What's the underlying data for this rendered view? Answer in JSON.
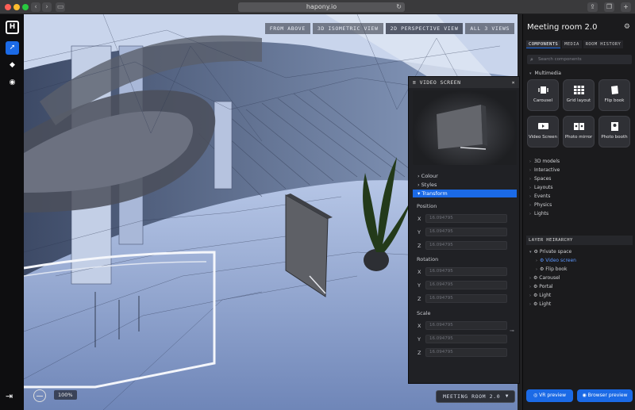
{
  "browser": {
    "url": "hapony.io"
  },
  "toolbar": {
    "logo": "H"
  },
  "viewport": {
    "view_tabs": [
      {
        "label": "FROM ABOVE",
        "active": false
      },
      {
        "label": "3D ISOMETRIC VIEW",
        "active": false
      },
      {
        "label": "2D PERSPECTIVE VIEW",
        "active": true
      },
      {
        "label": "ALL 3 VIEWS",
        "active": false
      }
    ],
    "zoom": "100%",
    "scene_select": "MEETING ROOM 2.0"
  },
  "video_panel": {
    "title": "VIDEO SCREEN",
    "links": [
      "Colour",
      "Styles",
      "Transform"
    ],
    "active_link": "Transform",
    "position_label": "Position",
    "rotation_label": "Rotation",
    "scale_label": "Scale",
    "axes": [
      "X",
      "Y",
      "Z"
    ],
    "position": [
      "16.094795",
      "16.094795",
      "16.094795"
    ],
    "rotation": [
      "16.094795",
      "16.094795",
      "16.094795"
    ],
    "scale": [
      "16.094795",
      "16.094795",
      "16.094795"
    ]
  },
  "right_panel": {
    "title": "Meeting room 2.0",
    "tabs": [
      {
        "label": "COMPONENTS",
        "active": true
      },
      {
        "label": "MEDIA",
        "active": false
      },
      {
        "label": "ROOM HISTORY",
        "active": false
      }
    ],
    "search_placeholder": "Search components",
    "multimedia_label": "Multimedia",
    "tiles": [
      {
        "label": "Carousel",
        "icon": "carousel-icon"
      },
      {
        "label": "Grid layout",
        "icon": "grid-icon"
      },
      {
        "label": "Flip book",
        "icon": "book-icon"
      },
      {
        "label": "Video Screen",
        "icon": "video-icon"
      },
      {
        "label": "Photo mirror",
        "icon": "mirror-icon"
      },
      {
        "label": "Photo booth",
        "icon": "camera-icon"
      }
    ],
    "categories": [
      "3D models",
      "Interactive",
      "Spaces",
      "Layouts",
      "Events",
      "Physics",
      "Lights"
    ],
    "hierarchy_title": "LAYER HEIRARCHY",
    "hierarchy": [
      {
        "label": "Private space",
        "level": 0,
        "selected": false
      },
      {
        "label": "Video screen",
        "level": 1,
        "selected": true
      },
      {
        "label": "Flip book",
        "level": 1,
        "selected": false
      },
      {
        "label": "Carousel",
        "level": 0,
        "selected": false
      },
      {
        "label": "Portal",
        "level": 0,
        "selected": false
      },
      {
        "label": "Light",
        "level": 0,
        "selected": false
      },
      {
        "label": "Light",
        "level": 0,
        "selected": false
      }
    ],
    "vr_preview": "VR preview",
    "browser_preview": "Browser preview"
  }
}
